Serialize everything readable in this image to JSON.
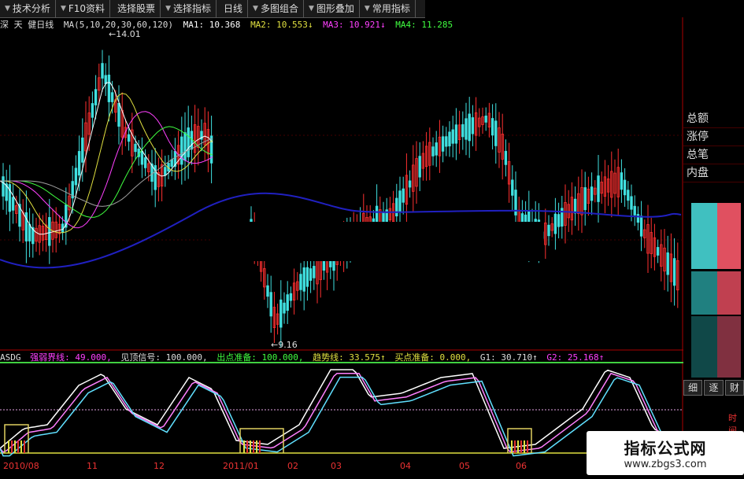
{
  "toolbar": {
    "buttons": [
      {
        "label": "技术分析",
        "arrow": "▼"
      },
      {
        "label": "F10资料",
        "arrow": "▼"
      },
      {
        "label": "选择股票",
        "arrow": ""
      },
      {
        "label": "选择指标",
        "arrow": "▼"
      },
      {
        "label": "日线",
        "arrow": ""
      },
      {
        "label": "多图组合",
        "arrow": "▼"
      },
      {
        "label": "图形叠加",
        "arrow": "▼"
      },
      {
        "label": "常用指标",
        "arrow": "▼"
      }
    ]
  },
  "infobar": {
    "stock": "深 天 健日线",
    "ma_params": "MA(5,10,20,30,60,120)",
    "ma1": "MA1: 10.368",
    "ma2": "MA2: 10.553↓",
    "ma3": "MA3: 10.921↓",
    "ma4": "MA4: 11.285"
  },
  "price_labels": {
    "high": "←14.01",
    "low": "←9.16"
  },
  "indicator": {
    "name": "ASDG",
    "strong_weak_line": "强弱界线: 49.000,",
    "top_signal": "见顶信号: 100.000,",
    "exit_prepare": "出点准备: 100.000,",
    "trend_line": "趋势线: 33.575↑",
    "buy_prepare": "买点准备: 0.000,",
    "g1": "G1: 30.710↑",
    "g2": "G2: 25.168↑"
  },
  "right_panel": {
    "labels": [
      "总额",
      "涨停",
      "总笔",
      "内盘"
    ],
    "tabs": [
      "细",
      "逐",
      "财"
    ],
    "time_label": "时间"
  },
  "xaxis": {
    "labels": [
      "2010/08",
      "11",
      "12",
      "2011/01",
      "02",
      "03",
      "04",
      "05",
      "06"
    ]
  },
  "watermark": {
    "title": "指标公式网",
    "url": "www.zbgs3.com"
  },
  "colors": {
    "ma1": "#ffffff",
    "ma2": "#e0e040",
    "ma3": "#ff40ff",
    "ma4": "#40ff40",
    "ma60": "#2020c0",
    "up": "#ff3030",
    "down": "#40e0e0"
  }
}
